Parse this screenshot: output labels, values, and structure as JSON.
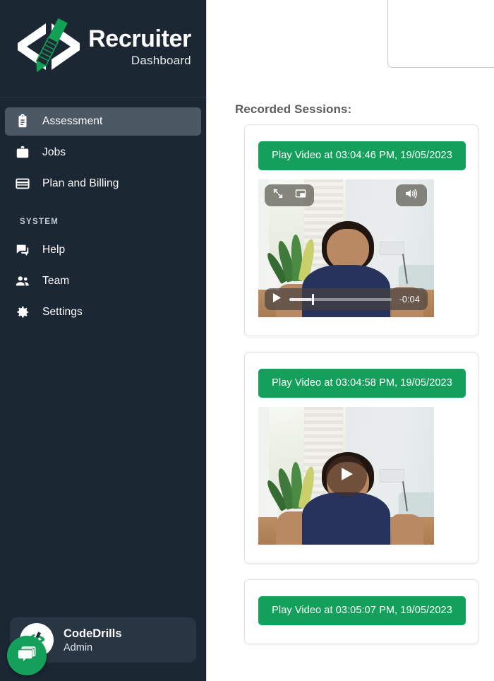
{
  "brand": {
    "title": "Recruiter",
    "subtitle": "Dashboard",
    "logo_icon": "code-brackets-pencil-logo",
    "accent_green": "#14a05a",
    "sidebar_bg": "#1b2733",
    "active_item_bg": "#4c5864"
  },
  "sidebar": {
    "items": [
      {
        "label": "Assessment",
        "icon": "clipboard-icon",
        "active": true
      },
      {
        "label": "Jobs",
        "icon": "briefcase-icon",
        "active": false
      },
      {
        "label": "Plan and Billing",
        "icon": "credit-card-icon",
        "active": false
      }
    ],
    "section_label": "SYSTEM",
    "system_items": [
      {
        "label": "Help",
        "icon": "chat-help-icon",
        "active": false
      },
      {
        "label": "Team",
        "icon": "people-icon",
        "active": false
      },
      {
        "label": "Settings",
        "icon": "gear-icon",
        "active": false
      }
    ],
    "profile": {
      "name": "CodeDrills",
      "role": "Admin",
      "avatar_icon": "codedrills-logo-avatar"
    },
    "chat_fab_icon": "chat-bubbles-icon"
  },
  "main": {
    "sessions_heading": "Recorded Sessions:",
    "cards": [
      {
        "button_label": "Play Video at 03:04:46 PM, 19/05/2023",
        "has_video": true,
        "state": "playing",
        "controls": {
          "fullscreen_icon": "fullscreen-expand-icon",
          "pip_icon": "picture-in-picture-icon",
          "volume_icon": "volume-high-icon",
          "play_icon": "play-icon",
          "time_remaining": "-0:04",
          "progress_percent": 22
        }
      },
      {
        "button_label": "Play Video at 03:04:58 PM, 19/05/2023",
        "has_video": true,
        "state": "paused",
        "controls": {
          "play_icon": "play-icon"
        }
      },
      {
        "button_label": "Play Video at 03:05:07 PM, 19/05/2023",
        "has_video": false,
        "state": "collapsed",
        "controls": {}
      }
    ]
  }
}
